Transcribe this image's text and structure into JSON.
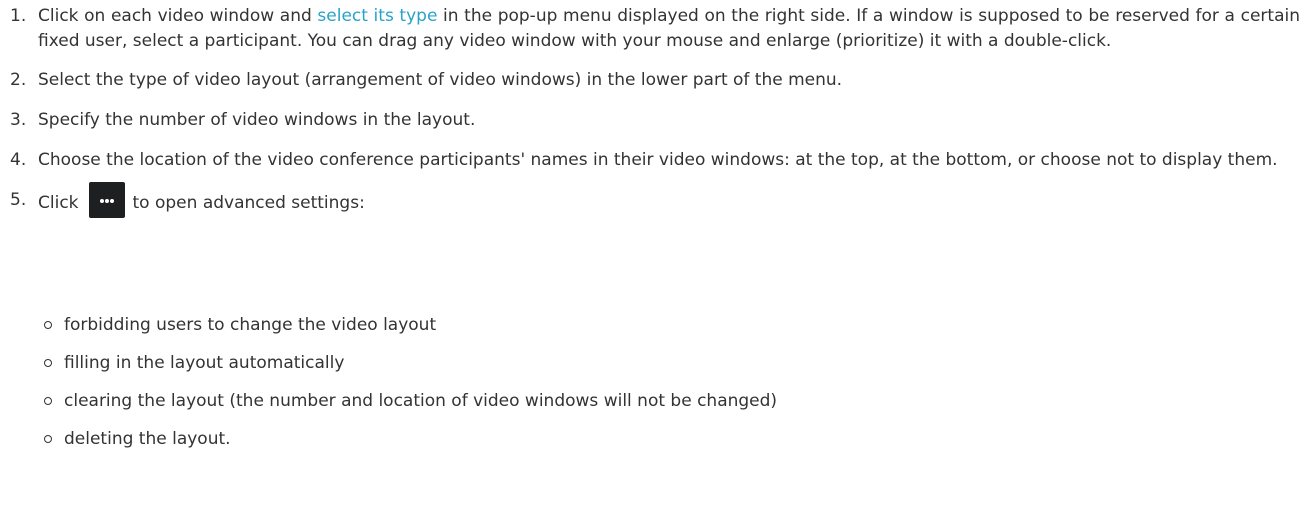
{
  "steps": [
    {
      "number": "1.",
      "before_link": "Click on each video window and ",
      "link": "select its type",
      "after_link": " in the pop-up menu displayed on the right side. If a window is supposed to be reserved for a certain fixed user, select a participant. You can drag any video window with your mouse and enlarge (prioritize) it with a double-click."
    },
    {
      "number": "2.",
      "text": "Select the type of video layout (arrangement of video windows) in the lower part of the menu."
    },
    {
      "number": "3.",
      "text": "Specify the number of video windows in the layout."
    },
    {
      "number": "4.",
      "text": "Choose the location of the video conference participants' names in their video windows: at the top, at the bottom, or choose not to display them."
    },
    {
      "number": "5.",
      "before_button": "Click",
      "button_icon": "more-dots-icon",
      "after_button": "to open advanced settings:"
    }
  ],
  "advanced_settings": [
    "forbidding users to change the video layout",
    "filling in the layout automatically",
    "clearing the layout (the number and location of video windows will not be changed)",
    "deleting the layout."
  ],
  "colors": {
    "text": "#333333",
    "link": "#29a3c7",
    "button_bg": "#1e1f21",
    "button_icon": "#ffffff"
  }
}
